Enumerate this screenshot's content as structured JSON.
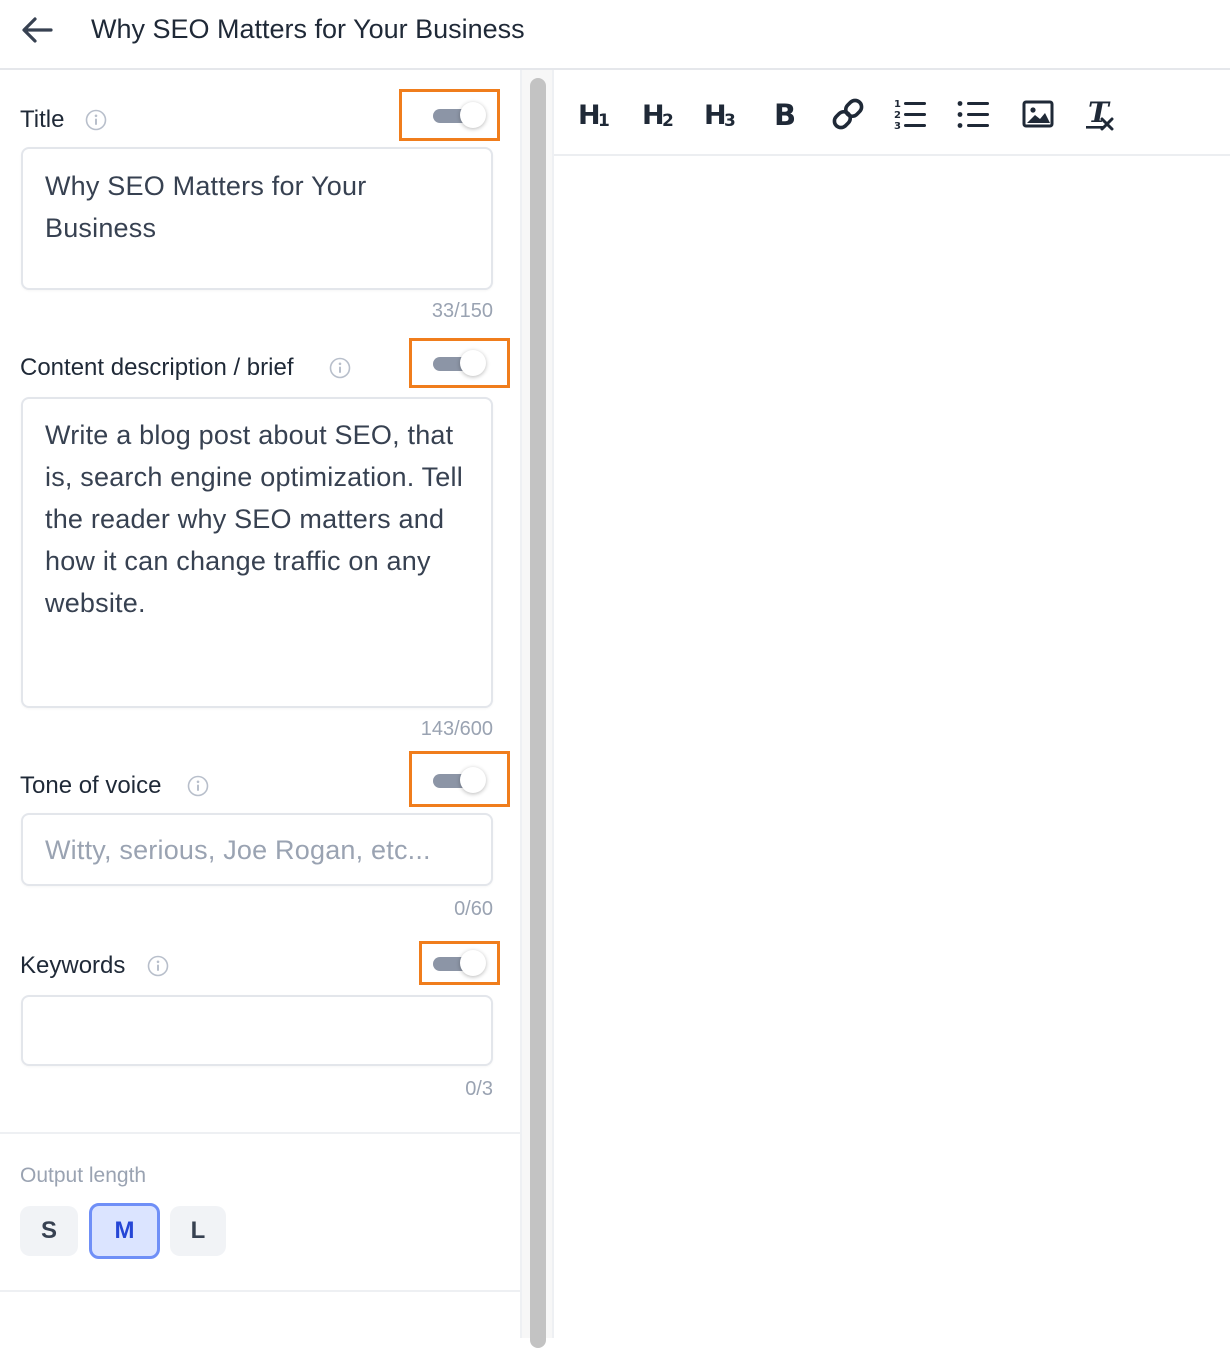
{
  "header": {
    "title": "Why SEO Matters for Your Business"
  },
  "fields": {
    "title": {
      "label": "Title",
      "value": "Why SEO Matters for Your Business",
      "counter": "33/150",
      "toggle_on": true
    },
    "description": {
      "label": "Content description / brief",
      "value": "Write a blog post about SEO, that is, search engine optimization. Tell the reader why SEO matters and how it can change traffic on any website.",
      "counter": "143/600",
      "toggle_on": true
    },
    "tone": {
      "label": "Tone of voice",
      "placeholder": "Witty, serious, Joe Rogan, etc...",
      "counter": "0/60",
      "toggle_on": true
    },
    "keywords": {
      "label": "Keywords",
      "value": "",
      "counter": "0/3",
      "toggle_on": true
    }
  },
  "output_length": {
    "label": "Output length",
    "options": [
      "S",
      "M",
      "L"
    ],
    "selected": "M"
  },
  "toolbar": {
    "h1": "H1",
    "h2": "H2",
    "h3": "H3",
    "bold": "B",
    "icons": [
      "link-icon",
      "ordered-list-icon",
      "bullet-list-icon",
      "image-icon",
      "clear-format-icon"
    ]
  },
  "colors": {
    "highlight": "#f07d1c",
    "toggle_track": "#8c95a6",
    "selected_border": "#6f8ff7",
    "selected_bg": "#dbe4ff"
  }
}
